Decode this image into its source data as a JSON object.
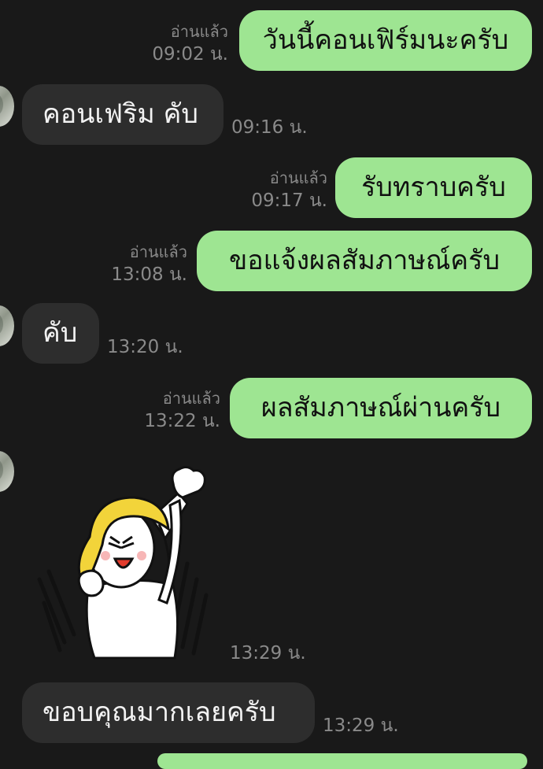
{
  "messages": [
    {
      "side": "out",
      "text": "วันนี้คอนเฟิร์มนะครับ",
      "read": "อ่านแล้ว",
      "time": "09:02 น."
    },
    {
      "side": "in",
      "text": "คอนเฟริม คับ",
      "time": "09:16 น."
    },
    {
      "side": "out",
      "text": "รับทราบครับ",
      "read": "อ่านแล้ว",
      "time": "09:17 น."
    },
    {
      "side": "out",
      "text": "ขอแจ้งผลสัมภาษณ์ครับ",
      "read": "อ่านแล้ว",
      "time": "13:08 น."
    },
    {
      "side": "in",
      "text": "คับ",
      "time": "13:20 น."
    },
    {
      "side": "out",
      "text": "ผลสัมภาษณ์ผ่านครับ",
      "read": "อ่านแล้ว",
      "time": "13:22 น."
    },
    {
      "side": "in",
      "type": "sticker",
      "sticker": "cheering-raised-fist-sticker",
      "time": "13:29 น."
    },
    {
      "side": "in",
      "text": "ขอบคุณมากเลยครับ",
      "time": "13:29 น."
    }
  ],
  "colors": {
    "background": "#191919",
    "outgoing_bubble": "#9ee592",
    "incoming_bubble": "#2d2d2d",
    "meta_text": "#8a8a8a"
  }
}
